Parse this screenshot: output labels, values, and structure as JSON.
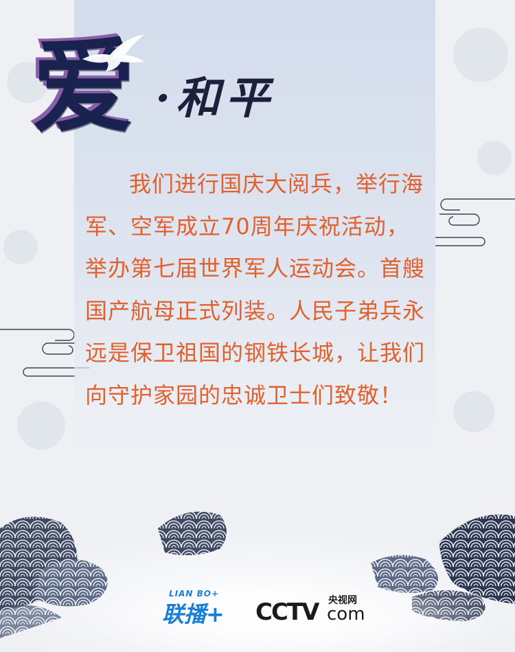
{
  "title": {
    "big_char": "爱",
    "subtitle": "·和平"
  },
  "body_text": "我们进行国庆大阅兵，举行海军、空军成立70周年庆祝活动，举办第七届世界军人运动会。首艘国产航母正式列装。人民子弟兵永远是保卫祖国的钢铁长城，让我们向守护家园的忠诚卫士们致敬！",
  "logos": {
    "lianbo_small": "LIAN BO+",
    "lianbo_main": "联播+",
    "cctv_text": "CCTV",
    "cctv_cn": "央视网",
    "cctv_com": "com"
  },
  "colors": {
    "body_text": "#e1602c",
    "panel": "#d3dcec",
    "title_blue": "#2c3f8a",
    "wave_dark": "#2e3a55"
  }
}
